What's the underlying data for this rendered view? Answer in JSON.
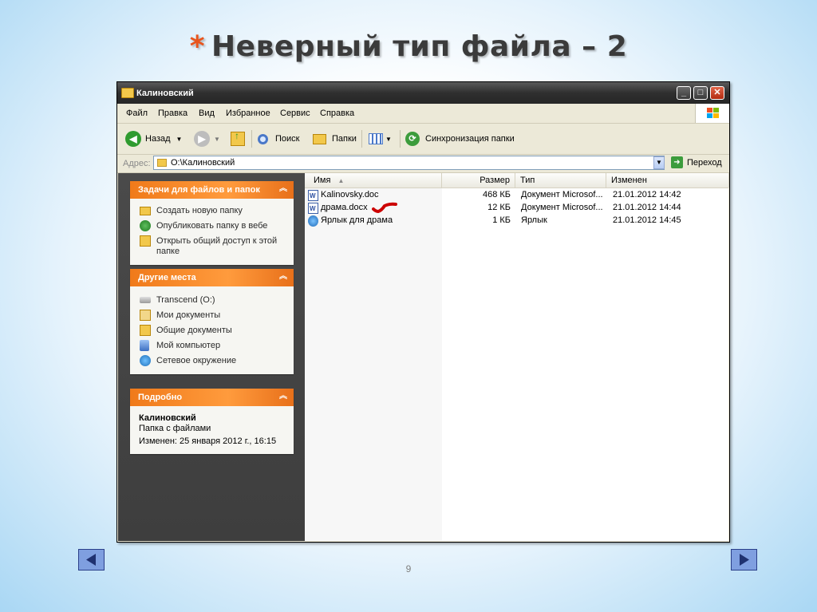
{
  "slide": {
    "star": "*",
    "title": "Неверный тип файла – 2",
    "page_number": "9"
  },
  "window": {
    "title": "Калиновский",
    "controls": {
      "minimize": "_",
      "maximize": "□",
      "close": "✕"
    }
  },
  "menu": [
    "Файл",
    "Правка",
    "Вид",
    "Избранное",
    "Сервис",
    "Справка"
  ],
  "toolbar": {
    "back": "Назад",
    "search": "Поиск",
    "folders": "Папки",
    "sync": "Синхронизация папки"
  },
  "address": {
    "label": "Адрес:",
    "value": "O:\\Калиновский",
    "go": "Переход"
  },
  "tasks_panel": {
    "title": "Задачи для файлов и папок",
    "items": [
      "Создать новую папку",
      "Опубликовать папку в вебе",
      "Открыть общий доступ к этой папке"
    ]
  },
  "places_panel": {
    "title": "Другие места",
    "items": [
      "Transcend (O:)",
      "Мои документы",
      "Общие документы",
      "Мой компьютер",
      "Сетевое окружение"
    ]
  },
  "details_panel": {
    "title": "Подробно",
    "name": "Калиновский",
    "type": "Папка с файлами",
    "modified": "Изменен: 25 января 2012 г., 16:15"
  },
  "columns": {
    "name": "Имя",
    "size": "Размер",
    "type": "Тип",
    "modified": "Изменен"
  },
  "files": [
    {
      "name": "Kalinovsky.doc",
      "size": "468 КБ",
      "type": "Документ Microsof...",
      "modified": "21.01.2012 14:42"
    },
    {
      "name": "драма.docx",
      "size": "12 КБ",
      "type": "Документ Microsof...",
      "modified": "21.01.2012 14:44"
    },
    {
      "name": "Ярлык для драма",
      "size": "1 КБ",
      "type": "Ярлык",
      "modified": "21.01.2012 14:45"
    }
  ],
  "colors": {
    "accent_star": "#e8541c",
    "panel_header": "#f07a1a",
    "checkmark": "#cc0000"
  }
}
